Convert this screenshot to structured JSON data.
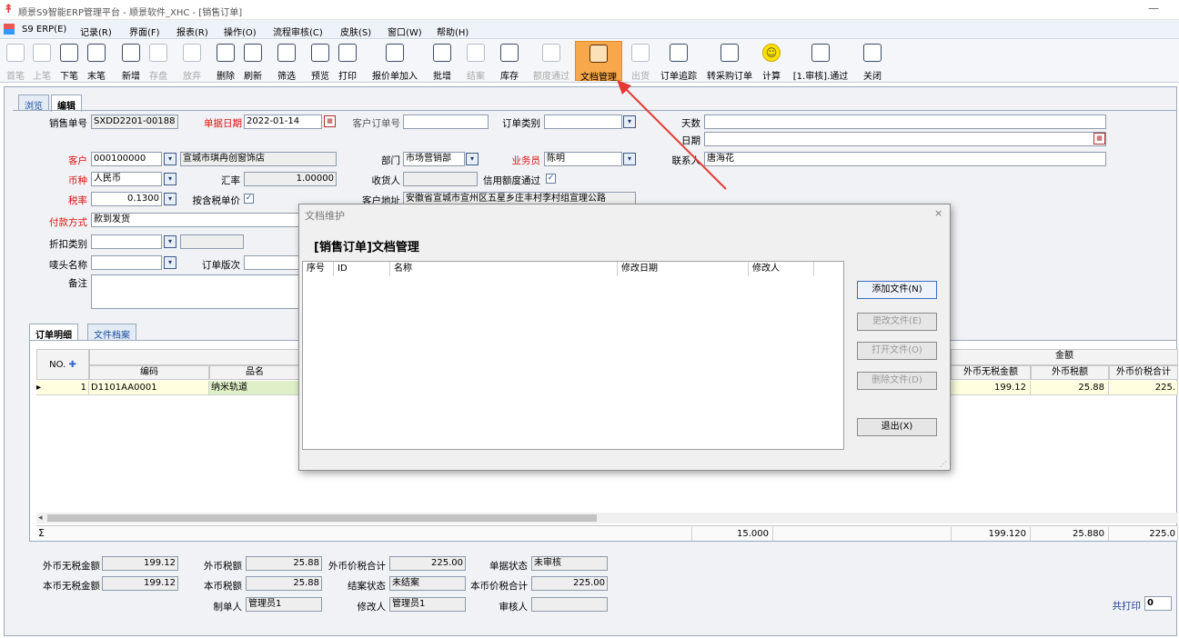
{
  "window": {
    "title": "顺景S9智能ERP管理平台 - 顺景软件_XHC - [销售订单]",
    "min": "—"
  },
  "menu": [
    "S9 ERP(E)",
    "记录(R)",
    "界面(F)",
    "报表(R)",
    "操作(O)",
    "流程审核(C)",
    "皮肤(S)",
    "窗口(W)",
    "帮助(H)"
  ],
  "toolbar": [
    {
      "label": "首笔",
      "icon": "first-record-icon",
      "disabled": true
    },
    {
      "label": "上笔",
      "icon": "prev-record-icon",
      "disabled": true
    },
    {
      "label": "下笔",
      "icon": "next-record-icon",
      "disabled": false
    },
    {
      "label": "末笔",
      "icon": "last-record-icon",
      "disabled": false
    },
    {
      "label": "新增",
      "icon": "add-icon",
      "disabled": false
    },
    {
      "label": "存盘",
      "icon": "save-icon",
      "disabled": true
    },
    {
      "label": "放弃",
      "icon": "discard-icon",
      "disabled": true
    },
    {
      "label": "删除",
      "icon": "delete-icon",
      "disabled": false
    },
    {
      "label": "刷新",
      "icon": "refresh-icon",
      "disabled": false
    },
    {
      "label": "筛选",
      "icon": "filter-icon",
      "disabled": false
    },
    {
      "label": "预览",
      "icon": "preview-icon",
      "disabled": false
    },
    {
      "label": "打印",
      "icon": "print-icon",
      "disabled": false
    },
    {
      "label": "报价单加入",
      "icon": "quote-add-icon",
      "disabled": false
    },
    {
      "label": "批增",
      "icon": "batch-add-icon",
      "disabled": false
    },
    {
      "label": "结案",
      "icon": "close-case-icon",
      "disabled": true
    },
    {
      "label": "库存",
      "icon": "inventory-icon",
      "disabled": false
    },
    {
      "label": "额度通过",
      "icon": "credit-pass-icon",
      "disabled": true
    },
    {
      "label": "文档管理",
      "icon": "document-manage-icon",
      "disabled": false,
      "active": true
    },
    {
      "label": "出货",
      "icon": "ship-icon",
      "disabled": true
    },
    {
      "label": "订单追踪",
      "icon": "order-track-icon",
      "disabled": false
    },
    {
      "label": "转采购订单",
      "icon": "to-purchase-icon",
      "disabled": false
    },
    {
      "label": "计算",
      "icon": "smiley-icon",
      "disabled": false
    },
    {
      "label": "[1.审核].通过",
      "icon": "approve-icon",
      "disabled": false
    },
    {
      "label": "关闭",
      "icon": "exit-icon",
      "disabled": false
    }
  ],
  "tabs": {
    "browse": "浏览",
    "edit": "编辑"
  },
  "form": {
    "order_no_label": "销售单号",
    "order_no": "SXDD2201-00188",
    "date_label": "单据日期",
    "date": "2022-01-14",
    "cust_order_label": "客户订单号",
    "cust_order": "",
    "order_type_label": "订单类别",
    "order_type": "",
    "days_label": "天数",
    "days": "",
    "date2_label": "日期",
    "date2": "",
    "customer_label": "客户",
    "customer_code": "000100000",
    "customer_name": "宣城市琪冉创窗饰店",
    "dept_label": "部门",
    "dept": "市场营销部",
    "salesman_label": "业务员",
    "salesman": "陈明",
    "contact_label": "联系人",
    "contact": "唐海花",
    "currency_label": "币种",
    "currency": "人民币",
    "rate_label": "汇率",
    "rate": "1.00000",
    "receiver_label": "收货人",
    "receiver": "",
    "credit_label": "信用额度通过",
    "tax_label": "税率",
    "tax": "0.1300",
    "taxincl_label": "按含税单价",
    "address_label": "客户地址",
    "address": "安徽省宣城市宣州区五星乡庄丰村李村组宣理公路",
    "payment_label": "付款方式",
    "payment": "款到发货",
    "discount_label": "折扣类别",
    "discount": "",
    "mark_label": "唛头名称",
    "mark": "",
    "version_label": "订单版次",
    "version": "",
    "remark_label": "备注",
    "remark": ""
  },
  "grid": {
    "tabs": [
      "订单明细",
      "文件档案"
    ],
    "no_header": "NO.",
    "code_header": "编码",
    "name_header": "品名",
    "amount_group": "金额",
    "fx_notax_header": "外币无税金额",
    "fx_tax_header": "外币税额",
    "fx_total_header": "外币价税合计",
    "row": {
      "no": "1",
      "code": "D1101AA0001",
      "name": "纳米轨道",
      "fx_notax": "199.12",
      "fx_tax": "25.88",
      "fx_total": "225."
    },
    "sigma": "Σ",
    "sum_qty": "15.000",
    "sum_fx_notax": "199.120",
    "sum_fx_tax": "25.880",
    "sum_fx_total": "225.0"
  },
  "footer": {
    "fx_notax_label": "外币无税金额",
    "fx_notax": "199.12",
    "fx_tax_label": "外币税额",
    "fx_tax": "25.88",
    "fx_total_label": "外币价税合计",
    "fx_total": "225.00",
    "status_label": "单据状态",
    "status": "未审核",
    "local_notax_label": "本币无税金额",
    "local_notax": "199.12",
    "local_tax_label": "本币税额",
    "local_tax": "25.88",
    "close_status_label": "结案状态",
    "close_status": "未结案",
    "local_total_label": "本币价税合计",
    "local_total": "225.00",
    "creator_label": "制单人",
    "creator": "管理员1",
    "modifier_label": "修改人",
    "modifier": "管理员1",
    "auditor_label": "审核人",
    "auditor": "",
    "print_label": "共打印",
    "print_count": "0"
  },
  "dialog": {
    "title": "文档维护",
    "close": "×",
    "heading": "[销售订单]文档管理",
    "columns": [
      "序号",
      "ID",
      "名称",
      "修改日期",
      "修改人"
    ],
    "buttons": {
      "add": "添加文件(N)",
      "change": "更改文件(E)",
      "open": "打开文件(O)",
      "delete": "删除文件(D)",
      "exit": "退出(X)"
    }
  },
  "colors": {
    "accent": "#f7a84a",
    "red_label": "#e01010",
    "arrow": "#e53935"
  }
}
